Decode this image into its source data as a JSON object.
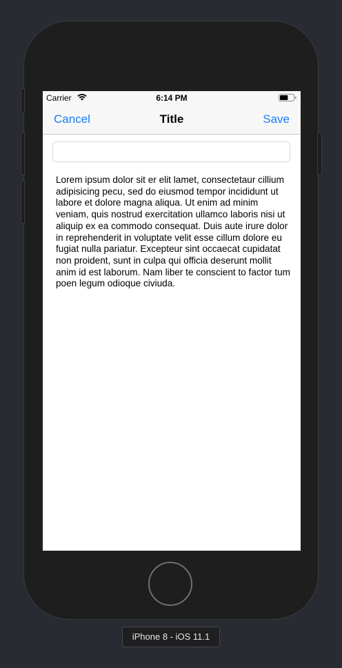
{
  "device": {
    "label": "iPhone 8 - iOS 11.1"
  },
  "statusbar": {
    "carrier": "Carrier",
    "time": "6:14 PM",
    "wifi_icon": "wifi-icon",
    "battery_icon": "battery-icon",
    "battery_level": 0.6
  },
  "navbar": {
    "cancel_label": "Cancel",
    "title": "Title",
    "save_label": "Save"
  },
  "text_field": {
    "value": "",
    "placeholder": ""
  },
  "body_text": "Lorem ipsum dolor sit er elit lamet, consectetaur cillium adipisicing pecu, sed do eiusmod tempor incididunt ut labore et dolore magna aliqua. Ut enim ad minim veniam, quis nostrud exercitation ullamco laboris nisi ut aliquip ex ea commodo consequat. Duis aute irure dolor in reprehenderit in voluptate velit esse cillum dolore eu fugiat nulla pariatur. Excepteur sint occaecat cupidatat non proident, sunt in culpa qui officia deserunt mollit anim id est laborum. Nam liber te conscient to factor tum poen legum odioque civiuda.",
  "colors": {
    "tint": "#147efb",
    "bar_background": "#f7f7f7",
    "background": "#282b32"
  }
}
